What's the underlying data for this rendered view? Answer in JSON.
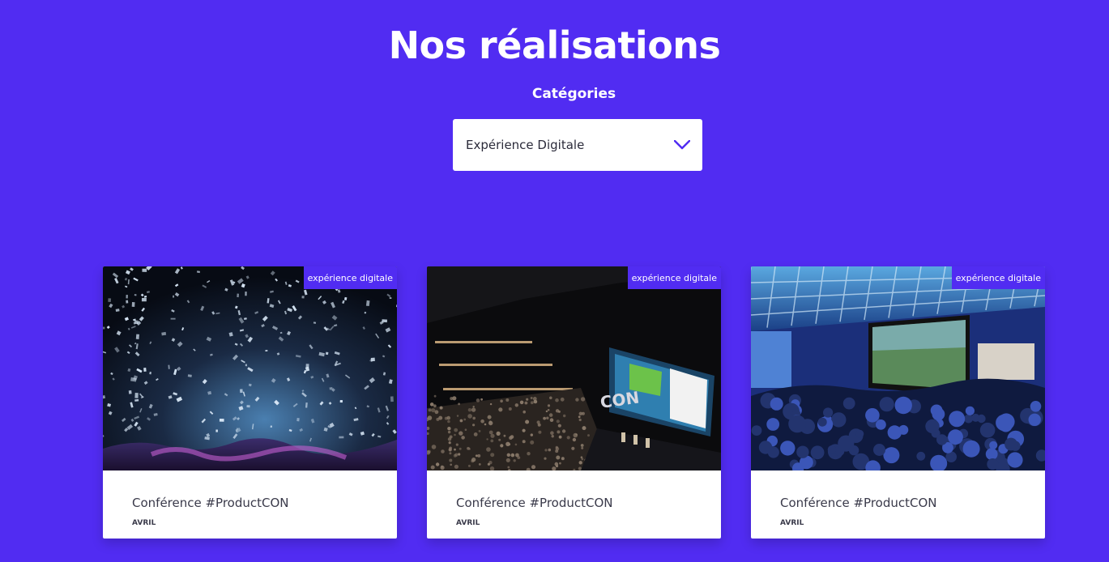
{
  "page": {
    "title": "Nos réalisations"
  },
  "filter": {
    "label": "Catégories",
    "selected": "Expérience Digitale",
    "icon": "chevron-down-icon"
  },
  "projects": [
    {
      "badge": "expérience digitale",
      "title": "Conférence #ProductCON",
      "date": "AVRIL",
      "image": "confetti-concert-photo"
    },
    {
      "badge": "expérience digitale",
      "title": "Conférence #ProductCON",
      "date": "AVRIL",
      "image": "productcon-auditorium-photo"
    },
    {
      "badge": "expérience digitale",
      "title": "Conférence #ProductCON",
      "date": "AVRIL",
      "image": "conference-room-screen-photo"
    }
  ],
  "colors": {
    "background": "#512cf2",
    "accent": "#512cf2",
    "card": "#ffffff"
  }
}
